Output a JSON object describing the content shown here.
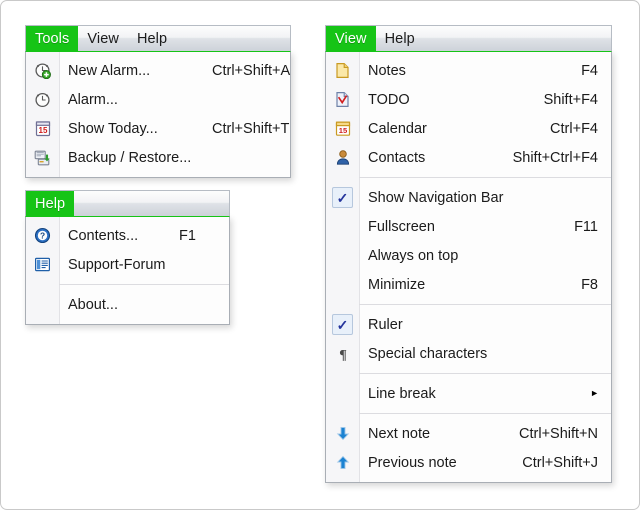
{
  "menus": [
    {
      "id": "tools",
      "bar": {
        "active_label": "Tools",
        "other_labels": [
          "View",
          "Help"
        ]
      },
      "items": [
        {
          "icon": "alarm-add-icon",
          "label": "New Alarm...",
          "shortcut": "Ctrl+Shift+A"
        },
        {
          "icon": "alarm-icon",
          "label": "Alarm...",
          "shortcut": ""
        },
        {
          "icon": "calendar-15-icon",
          "label": "Show Today...",
          "shortcut": "Ctrl+Shift+T"
        },
        {
          "icon": "backup-restore-icon",
          "label": "Backup / Restore...",
          "shortcut": ""
        }
      ]
    },
    {
      "id": "help",
      "bar": {
        "active_label": "Help",
        "other_labels": []
      },
      "items": [
        {
          "icon": "help-question-icon",
          "label": "Contents...",
          "shortcut": "F1"
        },
        {
          "icon": "forum-list-icon",
          "label": "Support-Forum",
          "shortcut": ""
        },
        {
          "icon": "separator",
          "label": "",
          "shortcut": ""
        },
        {
          "icon": "none",
          "label": "About...",
          "shortcut": ""
        }
      ]
    },
    {
      "id": "view",
      "bar": {
        "active_label": "View",
        "other_labels": [
          "Help"
        ]
      },
      "items": [
        {
          "icon": "note-page-icon",
          "label": "Notes",
          "shortcut": "F4"
        },
        {
          "icon": "todo-check-icon",
          "label": "TODO",
          "shortcut": "Shift+F4"
        },
        {
          "icon": "calendar-15-icon",
          "label": "Calendar",
          "shortcut": "Ctrl+F4"
        },
        {
          "icon": "contacts-person-icon",
          "label": "Contacts",
          "shortcut": "Shift+Ctrl+F4"
        },
        {
          "icon": "separator",
          "label": "",
          "shortcut": ""
        },
        {
          "icon": "checkmark",
          "label": "Show Navigation Bar",
          "shortcut": ""
        },
        {
          "icon": "none",
          "label": "Fullscreen",
          "shortcut": "F11"
        },
        {
          "icon": "none",
          "label": "Always on top",
          "shortcut": ""
        },
        {
          "icon": "none",
          "label": "Minimize",
          "shortcut": "F8"
        },
        {
          "icon": "separator",
          "label": "",
          "shortcut": ""
        },
        {
          "icon": "checkmark",
          "label": "Ruler",
          "shortcut": ""
        },
        {
          "icon": "pilcrow-icon",
          "label": "Special characters",
          "shortcut": ""
        },
        {
          "icon": "separator",
          "label": "",
          "shortcut": ""
        },
        {
          "icon": "none",
          "label": "Line break",
          "shortcut": "",
          "submenu": true
        },
        {
          "icon": "separator",
          "label": "",
          "shortcut": ""
        },
        {
          "icon": "arrow-down-icon",
          "label": "Next note",
          "shortcut": "Ctrl+Shift+N"
        },
        {
          "icon": "arrow-up-icon",
          "label": "Previous note",
          "shortcut": "Ctrl+Shift+J"
        }
      ]
    }
  ],
  "colors": {
    "accent_green": "#16c416",
    "menubar_top": "#fdfdfd",
    "menubar_bottom": "#cdd2d9",
    "dropdown_bg": "#fdfdfd",
    "gutter": "#f6f6f8",
    "check_blue": "#24349c",
    "arrow_blue": "#1b82d2"
  }
}
